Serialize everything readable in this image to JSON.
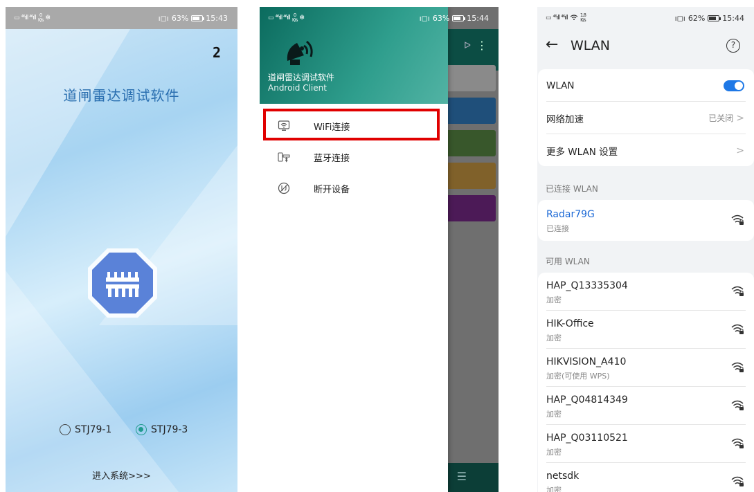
{
  "screen1": {
    "status": {
      "signal": "⁴⁶ıll ⁴⁶ıll",
      "speed_top": "0",
      "speed_unit": "K/s",
      "extra_icon": "✻",
      "vibrate": "ı◻ı",
      "battery": "63%",
      "battery_level": 0.63,
      "time": "15:43"
    },
    "counter": "2",
    "app_title": "道闸雷达调试软件",
    "radio_options": [
      {
        "label": "STJ79-1",
        "selected": false
      },
      {
        "label": "STJ79-3",
        "selected": true
      }
    ],
    "enter_label": "进入系统>>>",
    "colors": {
      "accent": "#1f9b8d",
      "title": "#2a6fb0",
      "logo": "#5a82d8"
    }
  },
  "screen2": {
    "status": {
      "signal": "⁴⁶ıll ⁴⁶ıll",
      "speed_top": "0",
      "speed_unit": "K/s",
      "extra_icon": "✻",
      "vibrate": "ı◻ı",
      "battery": "63%",
      "battery_level": 0.63,
      "time": "15:44"
    },
    "toolbar_text": "ᐅ",
    "toolbar_more": "⋮",
    "drawer": {
      "title": "道闸雷达调试软件",
      "subtitle": "Android Client",
      "items": [
        {
          "label": "WiFi连接",
          "icon": "wifi-monitor-icon"
        },
        {
          "label": "蓝牙连接",
          "icon": "bluetooth-device-icon"
        },
        {
          "label": "断开设备",
          "icon": "disconnect-icon"
        }
      ]
    },
    "colors": {
      "drawer_header": "#0b6b5e",
      "highlight": "#e00000"
    }
  },
  "screen3": {
    "status": {
      "signal": "⁴⁶ıll ⁴⁶ıll",
      "speed_top": "1.8",
      "speed_unit": "K/s",
      "vibrate": "ı◻ı",
      "battery": "62%",
      "battery_level": 0.62,
      "time": "15:44"
    },
    "back_icon": "←",
    "title": "WLAN",
    "help_icon": "?",
    "settings": [
      {
        "label": "WLAN",
        "type": "toggle",
        "on": true
      },
      {
        "label": "网络加速",
        "value": "已关闭",
        "chevron": ">"
      },
      {
        "label": "更多 WLAN 设置",
        "value": "",
        "chevron": ">"
      }
    ],
    "connected_section": "已连接 WLAN",
    "connected": {
      "name": "Radar79G",
      "status": "已连接"
    },
    "available_section": "可用 WLAN",
    "networks": [
      {
        "name": "HAP_Q13335304",
        "security": "加密"
      },
      {
        "name": "HIK-Office",
        "security": "加密"
      },
      {
        "name": "HIKVISION_A410",
        "security": "加密(可使用 WPS)"
      },
      {
        "name": "HAP_Q04814349",
        "security": "加密"
      },
      {
        "name": "HAP_Q03110521",
        "security": "加密"
      },
      {
        "name": "netsdk",
        "security": "加密"
      }
    ],
    "colors": {
      "accent": "#1e78e6",
      "background": "#f1f3f5"
    }
  }
}
